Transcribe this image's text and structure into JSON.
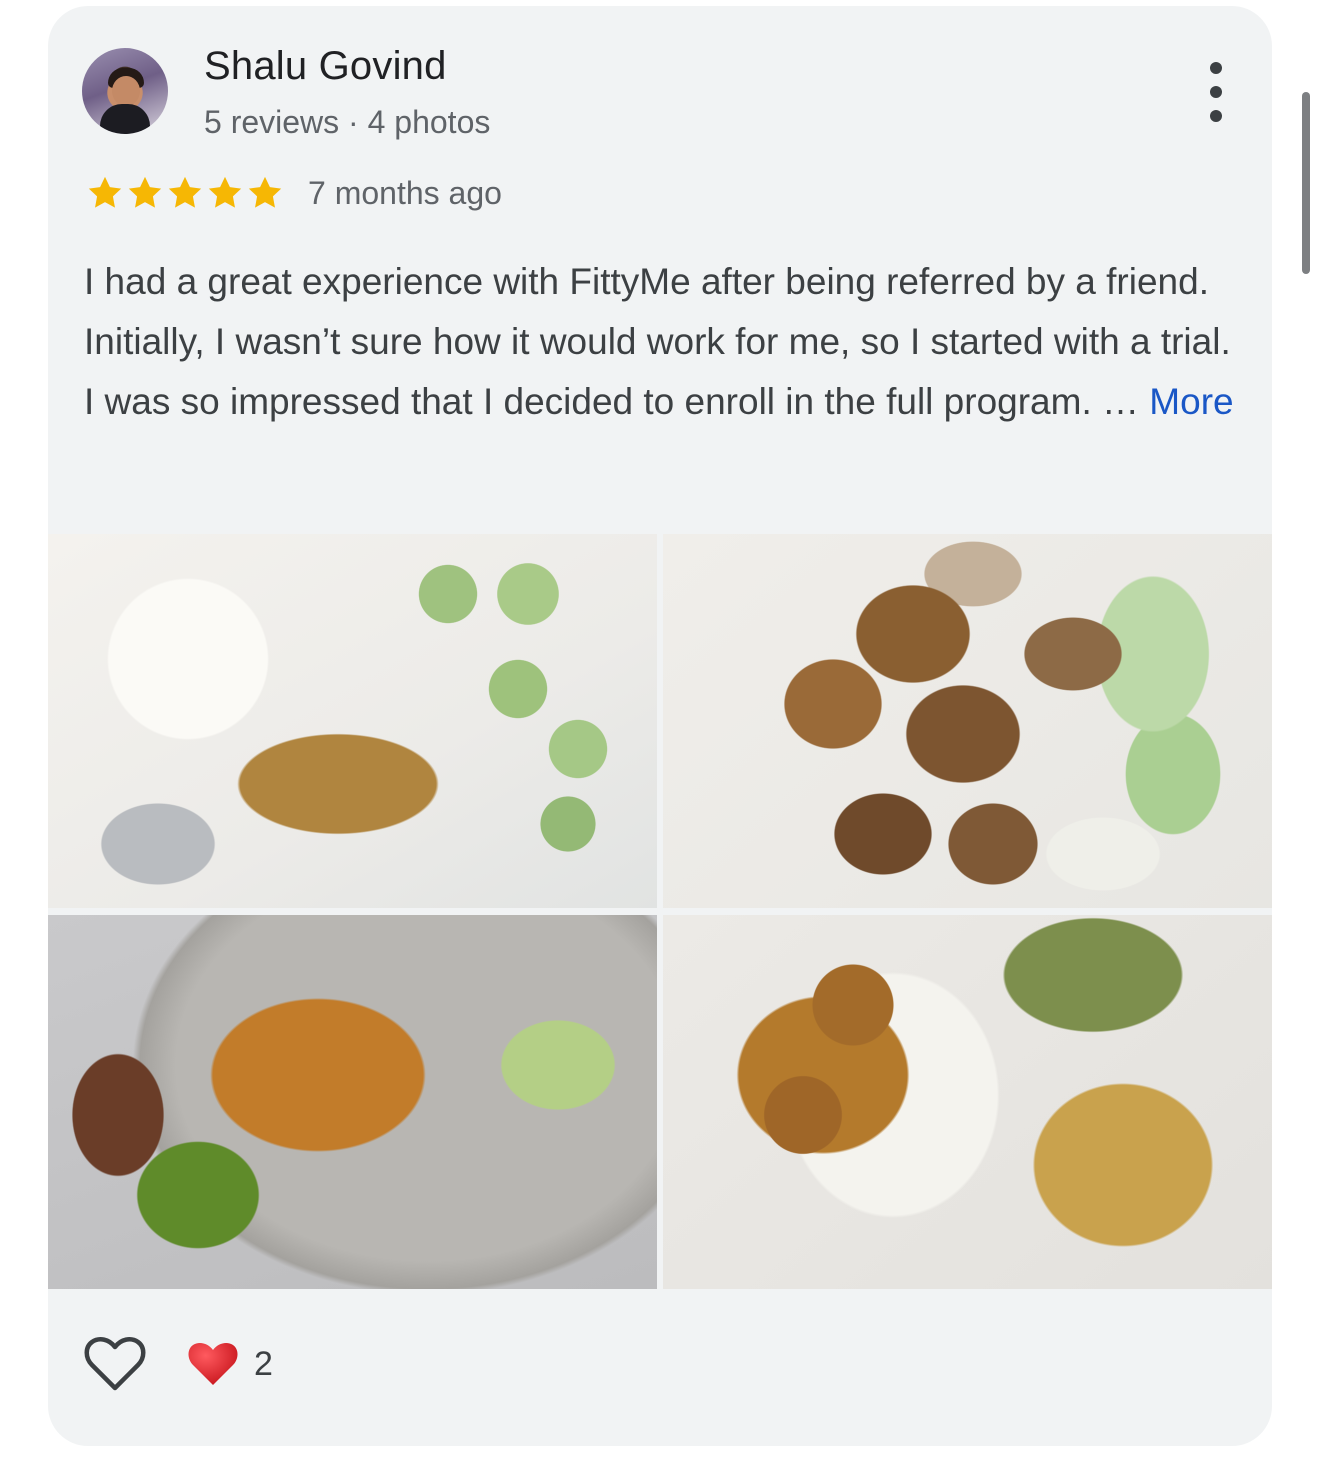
{
  "review": {
    "author": "Shalu Govind",
    "author_meta": "5 reviews · 4 photos",
    "rating": 5,
    "rating_max": 5,
    "time_ago": "7 months ago",
    "text": "I had a great experience with FittyMe after being referred by a friend. Initially, I wasn’t sure how it would work for me, so I started with a trial. I was so impressed that I decided to enroll in the full program. … ",
    "more_label": "More"
  },
  "photos": [
    {
      "name": "photo-yogurt-cucumber-chicken"
    },
    {
      "name": "photo-paneer-cucumber"
    },
    {
      "name": "photo-fish-peppers-guacamole"
    },
    {
      "name": "photo-curry-rice-omelette"
    }
  ],
  "actions": {
    "like_icon": "heart-outline-icon",
    "reaction_icon": "red-heart-icon",
    "reaction_count": "2"
  },
  "colors": {
    "card_bg": "#f1f3f4",
    "star": "#f6b704",
    "link": "#1a57c6",
    "reaction_heart": "#e0242b"
  }
}
